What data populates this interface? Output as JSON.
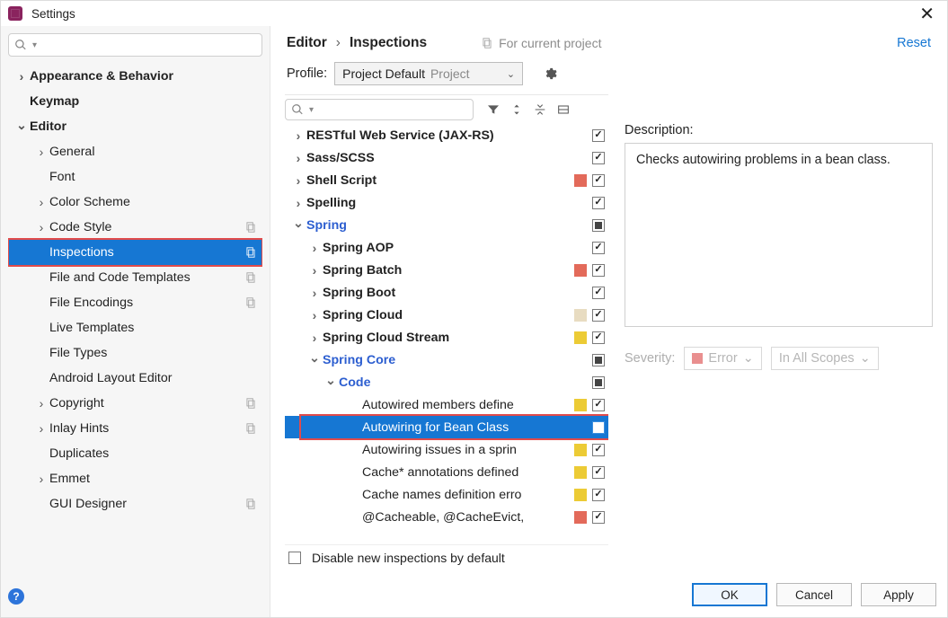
{
  "window": {
    "title": "Settings"
  },
  "breadcrumb": {
    "root": "Editor",
    "leaf": "Inspections"
  },
  "scope_label": "For current project",
  "reset_label": "Reset",
  "profile": {
    "label": "Profile:",
    "selected": "Project Default",
    "suffix": "Project"
  },
  "nav": {
    "items": [
      {
        "label": "Appearance & Behavior",
        "bold": true,
        "arrow": "right"
      },
      {
        "label": "Keymap",
        "bold": true,
        "arrow": "none"
      },
      {
        "label": "Editor",
        "bold": true,
        "arrow": "down"
      },
      {
        "label": "General",
        "arrow": "right"
      },
      {
        "label": "Font",
        "arrow": "none"
      },
      {
        "label": "Color Scheme",
        "arrow": "right"
      },
      {
        "label": "Code Style",
        "arrow": "right",
        "copy": true
      },
      {
        "label": "Inspections",
        "arrow": "none",
        "copy": true,
        "selected": true,
        "highlight": true
      },
      {
        "label": "File and Code Templates",
        "arrow": "none",
        "copy": true
      },
      {
        "label": "File Encodings",
        "arrow": "none",
        "copy": true
      },
      {
        "label": "Live Templates",
        "arrow": "none"
      },
      {
        "label": "File Types",
        "arrow": "none"
      },
      {
        "label": "Android Layout Editor",
        "arrow": "none"
      },
      {
        "label": "Copyright",
        "arrow": "right",
        "copy": true
      },
      {
        "label": "Inlay Hints",
        "arrow": "right",
        "copy": true
      },
      {
        "label": "Duplicates",
        "arrow": "none"
      },
      {
        "label": "Emmet",
        "arrow": "right"
      },
      {
        "label": "GUI Designer",
        "arrow": "none",
        "copy": true
      }
    ]
  },
  "tree": [
    {
      "indent": 0,
      "arrow": "right",
      "label": "RESTful Web Service (JAX-RS)",
      "bold": true,
      "chk": "checked"
    },
    {
      "indent": 0,
      "arrow": "right",
      "label": "Sass/SCSS",
      "bold": true,
      "chk": "checked"
    },
    {
      "indent": 0,
      "arrow": "right",
      "label": "Shell Script",
      "bold": true,
      "sev": "#e36a5a",
      "chk": "checked"
    },
    {
      "indent": 0,
      "arrow": "right",
      "label": "Spelling",
      "bold": true,
      "chk": "checked"
    },
    {
      "indent": 0,
      "arrow": "down",
      "label": "Spring",
      "link": true,
      "chk": "mixed"
    },
    {
      "indent": 1,
      "arrow": "right",
      "label": "Spring AOP",
      "bold": true,
      "chk": "checked"
    },
    {
      "indent": 1,
      "arrow": "right",
      "label": "Spring Batch",
      "bold": true,
      "sev": "#e36a5a",
      "chk": "checked"
    },
    {
      "indent": 1,
      "arrow": "right",
      "label": "Spring Boot",
      "bold": true,
      "chk": "checked"
    },
    {
      "indent": 1,
      "arrow": "right",
      "label": "Spring Cloud",
      "bold": true,
      "sev": "#e8dcc1",
      "chk": "checked"
    },
    {
      "indent": 1,
      "arrow": "right",
      "label": "Spring Cloud Stream",
      "bold": true,
      "sev": "#eccb35",
      "chk": "checked"
    },
    {
      "indent": 1,
      "arrow": "down",
      "label": "Spring Core",
      "link": true,
      "chk": "mixed"
    },
    {
      "indent": 2,
      "arrow": "down",
      "label": "Code",
      "link": true,
      "chk": "mixed"
    },
    {
      "indent": 3,
      "arrow": "none",
      "label": "Autowired members define",
      "sev": "#eccb35",
      "chk": "checked"
    },
    {
      "indent": 3,
      "arrow": "none",
      "label": "Autowiring for Bean Class",
      "chk": "none",
      "selected": true,
      "highlight": true
    },
    {
      "indent": 3,
      "arrow": "none",
      "label": "Autowiring issues in a sprin",
      "sev": "#eccb35",
      "chk": "checked"
    },
    {
      "indent": 3,
      "arrow": "none",
      "label": "Cache* annotations defined",
      "sev": "#eccb35",
      "chk": "checked"
    },
    {
      "indent": 3,
      "arrow": "none",
      "label": "Cache names definition erro",
      "sev": "#eccb35",
      "chk": "checked"
    },
    {
      "indent": 3,
      "arrow": "none",
      "label": "@Cacheable, @CacheEvict,",
      "sev": "#e36a5a",
      "chk": "checked"
    }
  ],
  "disable_label": "Disable new inspections by default",
  "details": {
    "desc_label": "Description:",
    "description": "Checks autowiring problems in a bean class.",
    "severity_label": "Severity:",
    "severity_value": "Error",
    "scope_value": "In All Scopes"
  },
  "buttons": {
    "ok": "OK",
    "cancel": "Cancel",
    "apply": "Apply"
  }
}
